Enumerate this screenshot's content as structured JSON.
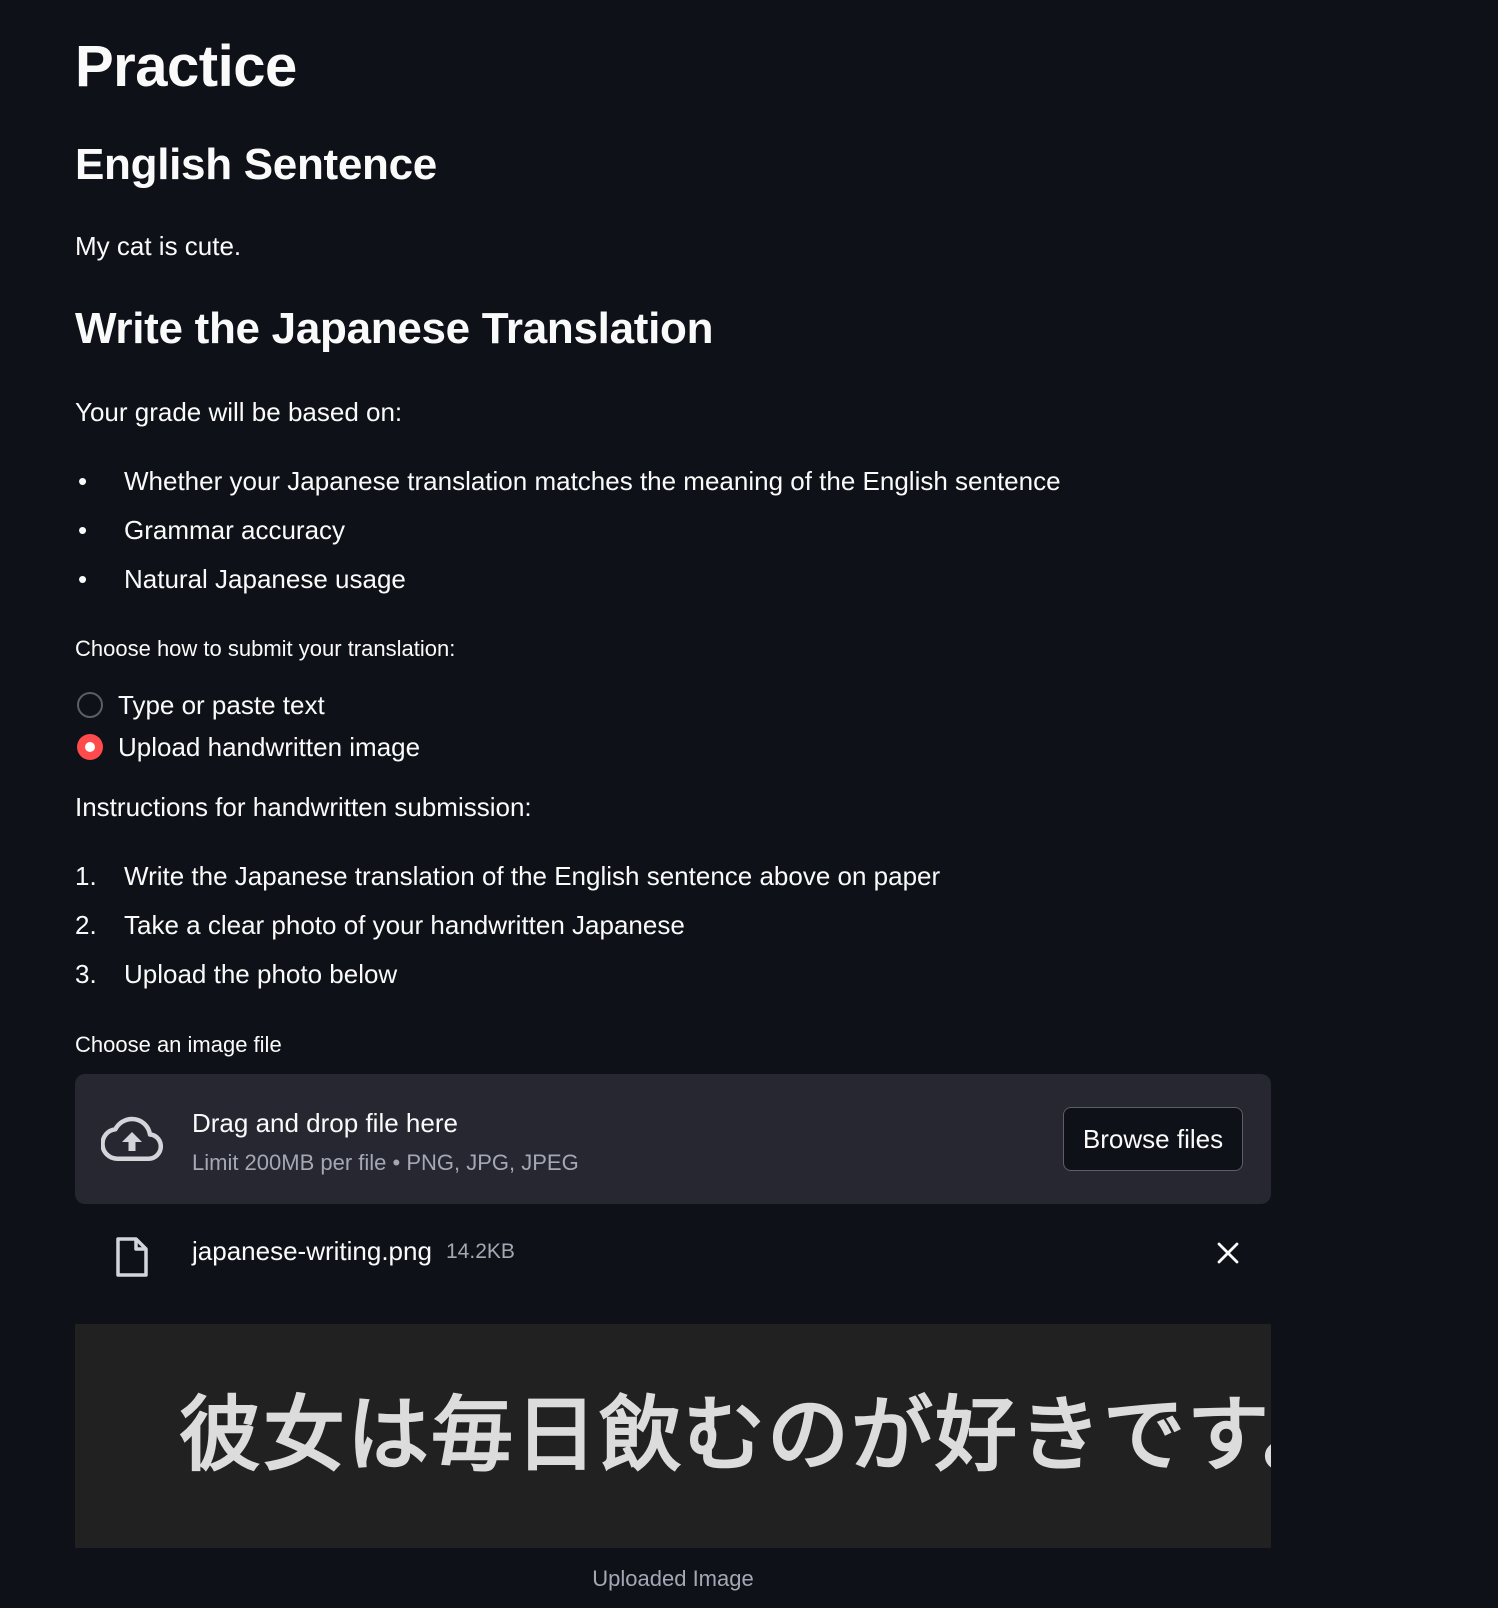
{
  "page": {
    "title": "Practice"
  },
  "sentence_section": {
    "heading": "English Sentence",
    "sentence": "My cat is cute."
  },
  "translation_section": {
    "heading": "Write the Japanese Translation",
    "grade_intro": "Your grade will be based on:",
    "criteria": [
      "Whether your Japanese translation matches the meaning of the English sentence",
      "Grammar accuracy",
      "Natural Japanese usage"
    ],
    "submit_method": {
      "label": "Choose how to submit your translation:",
      "options": [
        {
          "label": "Type or paste text",
          "selected": false
        },
        {
          "label": "Upload handwritten image",
          "selected": true
        }
      ]
    },
    "instructions_heading": "Instructions for handwritten submission:",
    "steps": [
      {
        "num": "1.",
        "text": "Write the Japanese translation of the English sentence above on paper"
      },
      {
        "num": "2.",
        "text": "Take a clear photo of your handwritten Japanese"
      },
      {
        "num": "3.",
        "text": "Upload the photo below"
      }
    ]
  },
  "uploader": {
    "label": "Choose an image file",
    "dropzone_title": "Drag and drop file here",
    "dropzone_subtitle": "Limit 200MB per file • PNG, JPG, JPEG",
    "browse_label": "Browse files",
    "icon": "cloud-upload-icon",
    "file": {
      "name": "japanese-writing.png",
      "size": "14.2KB",
      "icon": "file-icon",
      "remove_icon": "close-icon"
    }
  },
  "uploaded_image": {
    "text": "彼女は毎日飲むのが好きです。",
    "caption": "Uploaded Image"
  },
  "colors": {
    "background": "#0e1117",
    "text": "#fafafa",
    "accent": "#ff4b4b",
    "dropzone_bg": "#262730",
    "muted_text": "#a3a8b4",
    "image_bg": "#212121"
  }
}
